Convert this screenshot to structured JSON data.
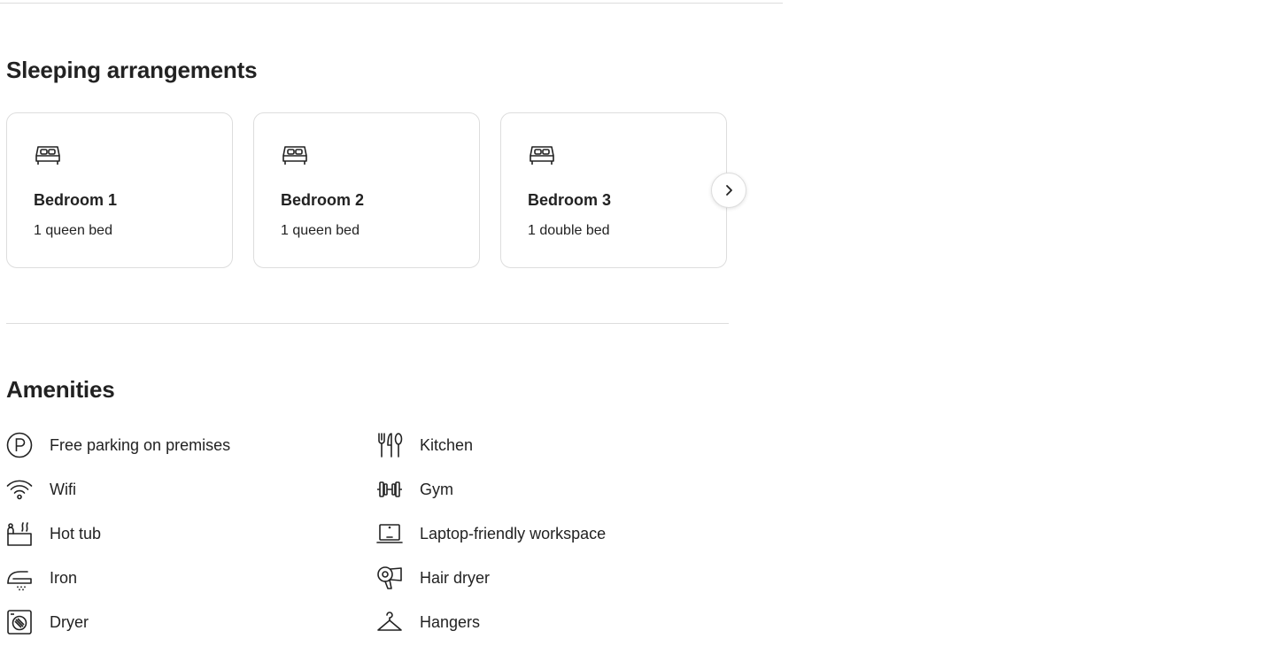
{
  "sleeping": {
    "title": "Sleeping arrangements",
    "bedrooms": [
      {
        "name": "Bedroom 1",
        "beds": "1 queen bed",
        "icon": "bed-icon"
      },
      {
        "name": "Bedroom 2",
        "beds": "1 queen bed",
        "icon": "bed-icon"
      },
      {
        "name": "Bedroom 3",
        "beds": "1 double bed",
        "icon": "bed-icon"
      }
    ],
    "next_icon": "chevron-right-icon"
  },
  "amenities": {
    "title": "Amenities",
    "left": [
      {
        "label": "Free parking on premises",
        "icon": "parking-icon"
      },
      {
        "label": "Wifi",
        "icon": "wifi-icon"
      },
      {
        "label": "Hot tub",
        "icon": "hot-tub-icon"
      },
      {
        "label": "Iron",
        "icon": "iron-icon"
      },
      {
        "label": "Dryer",
        "icon": "dryer-icon"
      }
    ],
    "right": [
      {
        "label": "Kitchen",
        "icon": "kitchen-icon"
      },
      {
        "label": "Gym",
        "icon": "gym-icon"
      },
      {
        "label": "Laptop-friendly workspace",
        "icon": "laptop-icon"
      },
      {
        "label": "Hair dryer",
        "icon": "hair-dryer-icon"
      },
      {
        "label": "Hangers",
        "icon": "hanger-icon"
      }
    ]
  },
  "colors": {
    "text": "#222222",
    "divider": "#dddddd"
  }
}
